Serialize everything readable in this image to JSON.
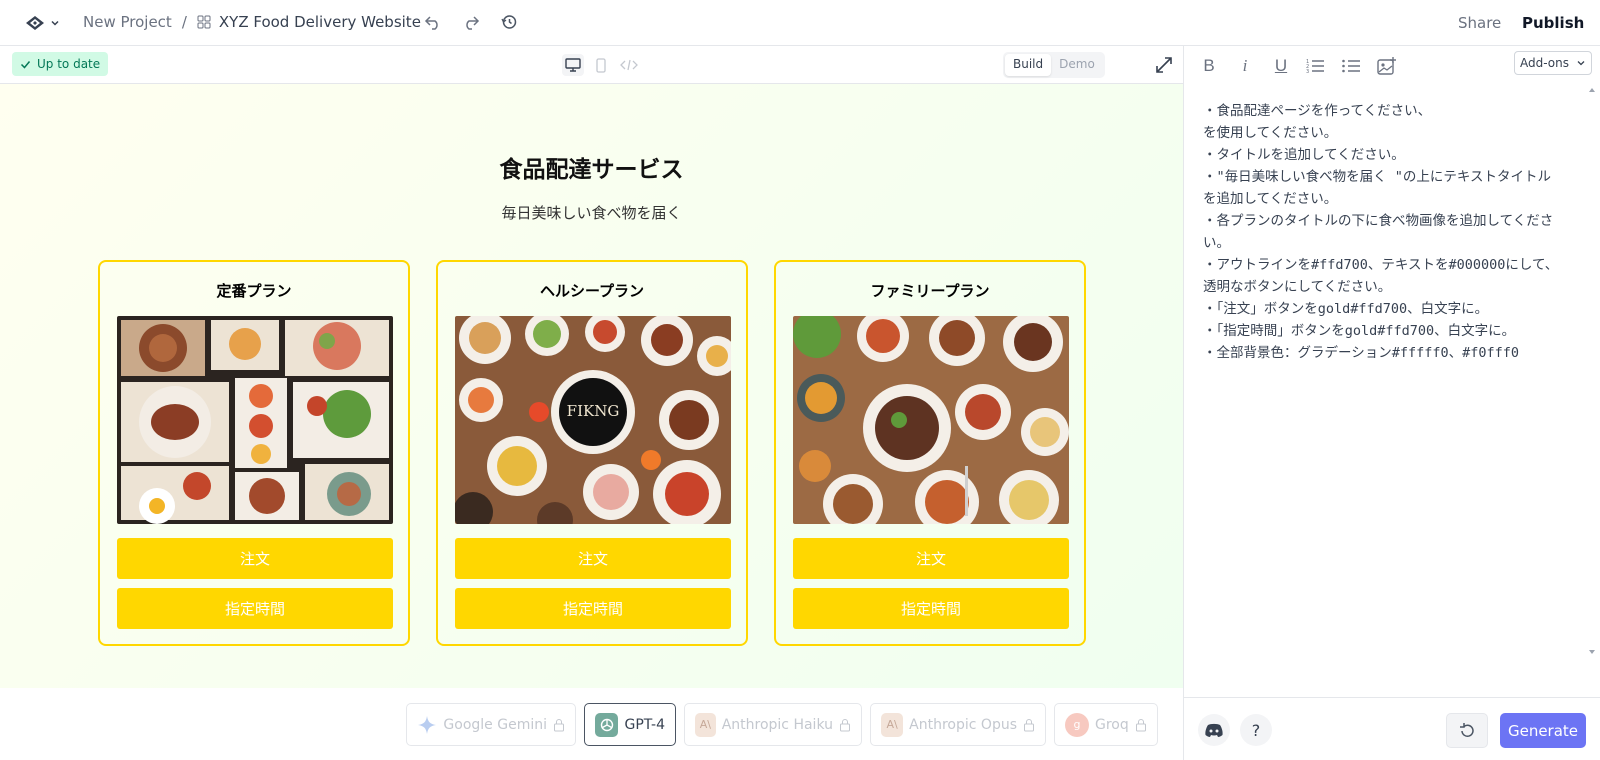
{
  "header": {
    "project": "New Project",
    "separator": "/",
    "site_name": "XYZ Food Delivery Website",
    "share_label": "Share",
    "publish_label": "Publish"
  },
  "preview_toolbar": {
    "status": "Up to date",
    "modes": [
      "Build",
      "Demo"
    ],
    "active_mode": "Build"
  },
  "site": {
    "title": "食品配達サービス",
    "subtitle": "毎日美味しい食べ物を届く",
    "plans": [
      {
        "title": "定番プラン",
        "order": "注文",
        "schedule": "指定時間"
      },
      {
        "title": "ヘルシープラン",
        "order": "注文",
        "schedule": "指定時間"
      },
      {
        "title": "ファミリープラン",
        "order": "注文",
        "schedule": "指定時間"
      }
    ],
    "colors": {
      "outline": "#ffd700",
      "button": "#ffd700",
      "button_text": "#ffffff",
      "bg_from": "#fffff0",
      "bg_to": "#f0fff0"
    }
  },
  "models": [
    {
      "name": "Google Gemini",
      "icon": "gemini-icon",
      "selected": false,
      "locked": true
    },
    {
      "name": "GPT-4",
      "icon": "openai-icon",
      "selected": true,
      "locked": false
    },
    {
      "name": "Anthropic Haiku",
      "icon": "anthropic-icon",
      "selected": false,
      "locked": true
    },
    {
      "name": "Anthropic Opus",
      "icon": "anthropic-icon",
      "selected": false,
      "locked": true
    },
    {
      "name": "Groq",
      "icon": "groq-icon",
      "selected": false,
      "locked": true
    }
  ],
  "editor": {
    "addons_label": "Add-ons",
    "prompt": "・食品配達ページを作ってください、\nを使用してください。\n・タイトルを追加してください。\n・\"毎日美味しい食べ物を届く \"の上にテキストタイトルを追加してください。\n・各プランのタイトルの下に食べ物画像を追加してください。\n・アウトラインを#ffd700、テキストを#000000にして、透明なボタンにしてください。\n・「注文」ボタンをgold#ffd700、白文字に。\n・「指定時間」ボタンをgold#ffd700、白文字に。\n・全部背景色：グラデーション#fffff0、#f0fff0",
    "help": "?",
    "generate_label": "Generate"
  }
}
